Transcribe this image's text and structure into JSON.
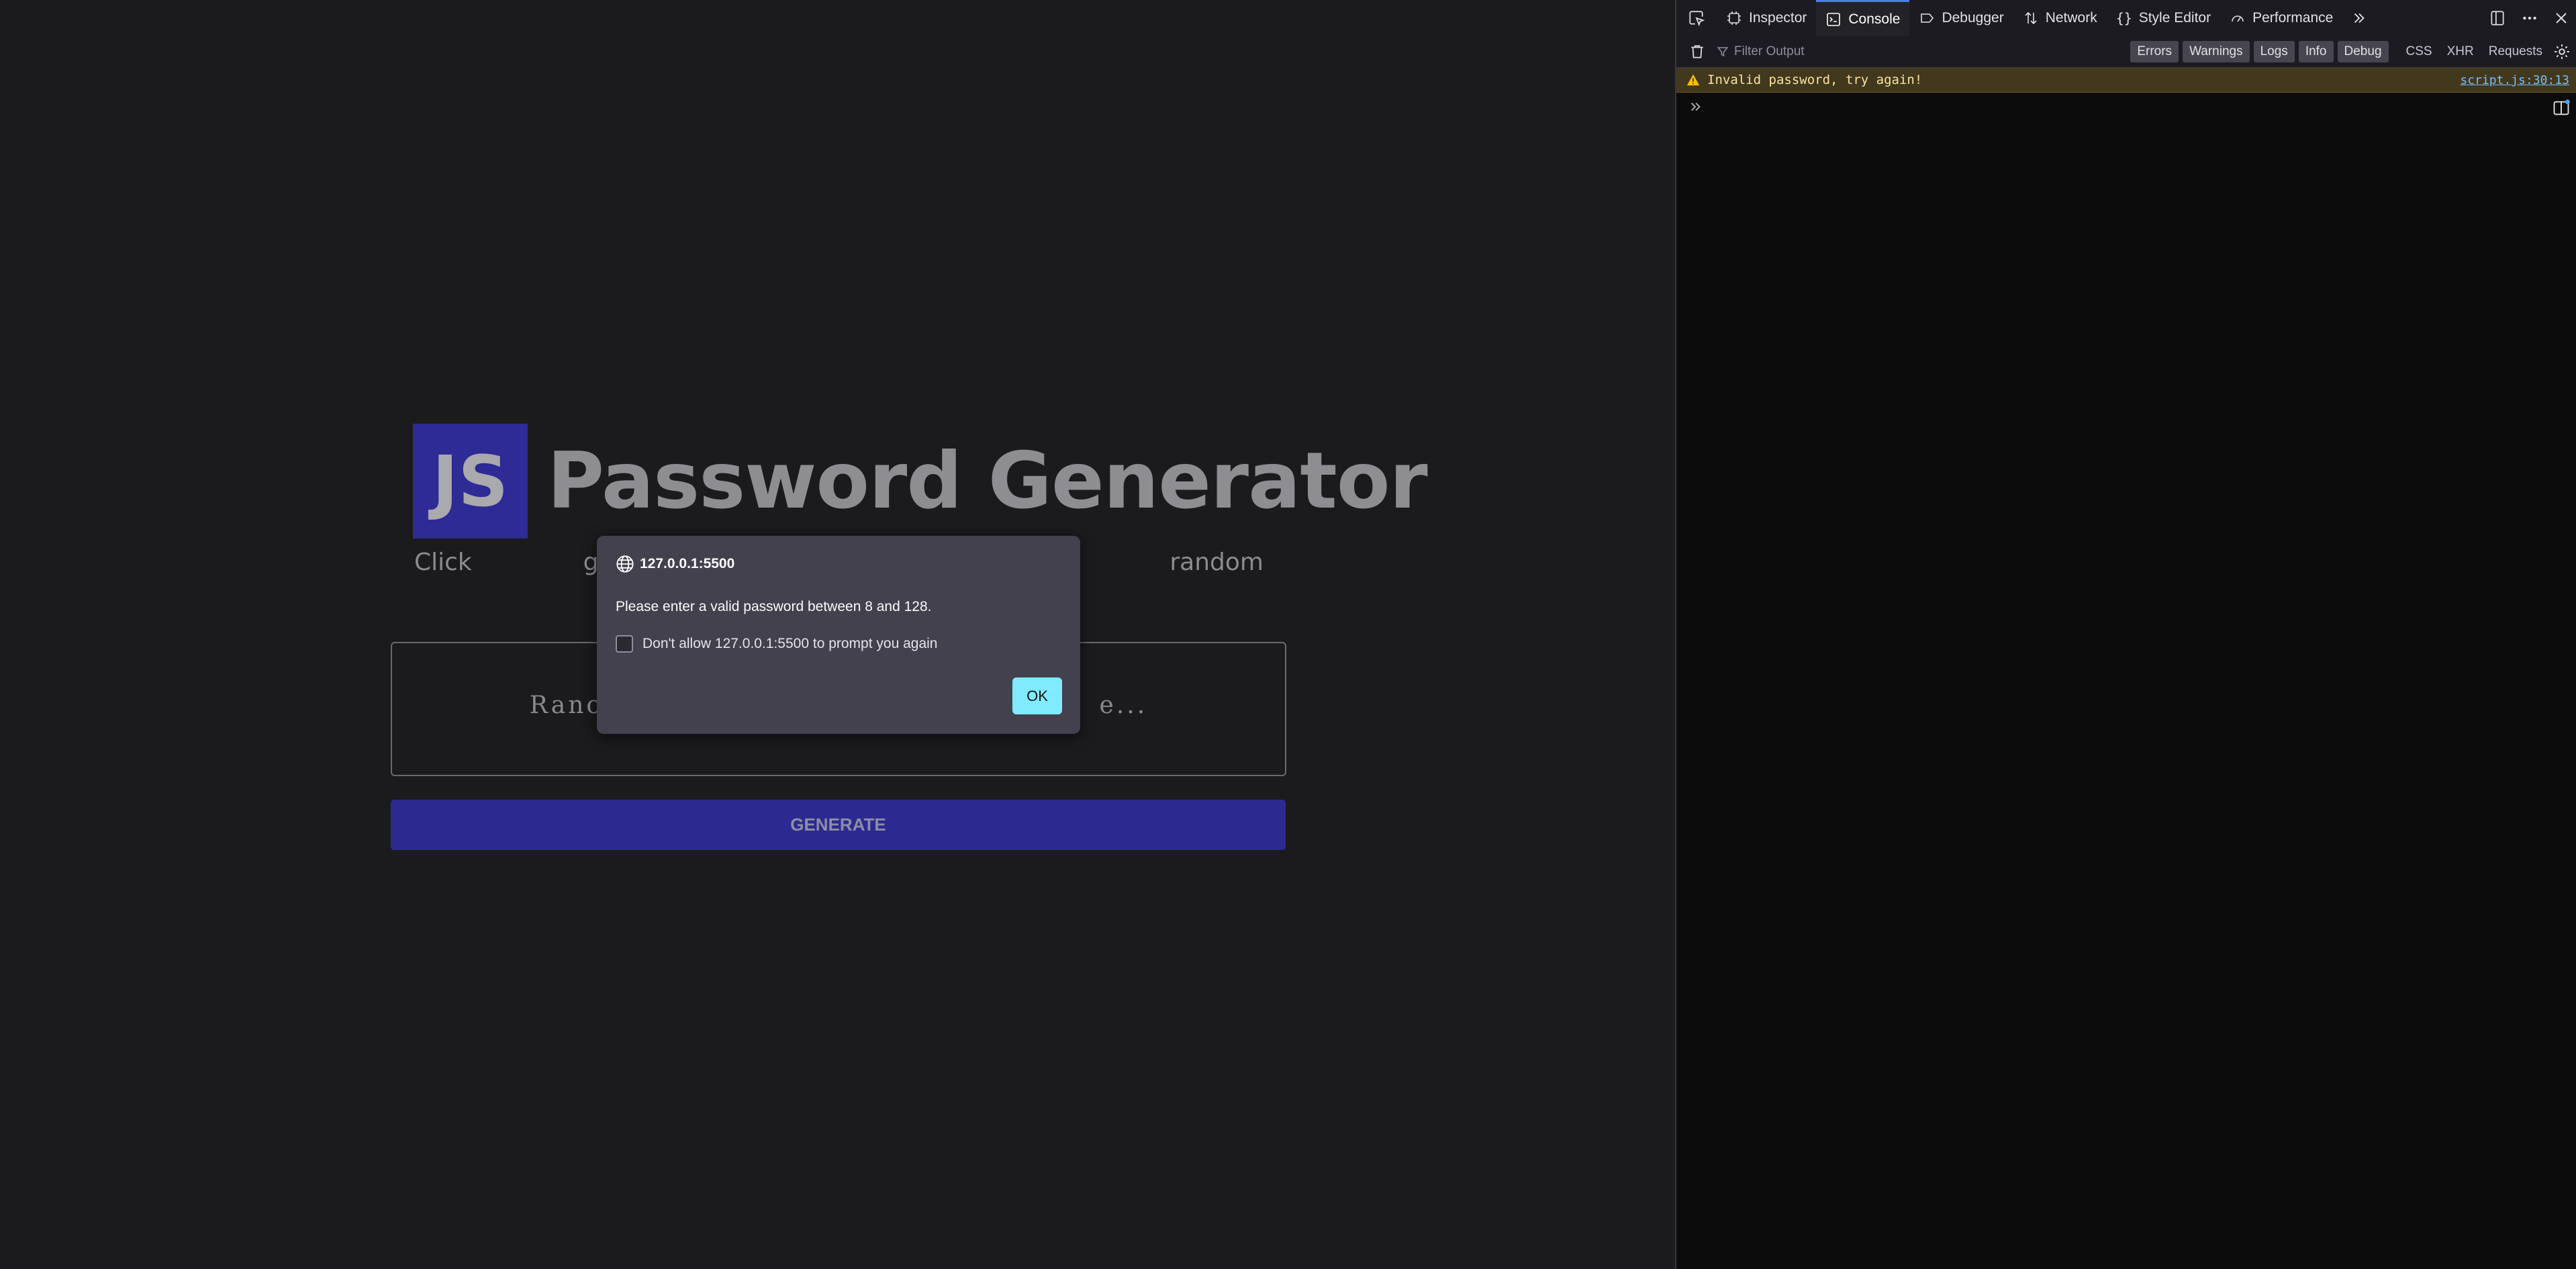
{
  "page": {
    "logo": "JS",
    "title": "Password Generator",
    "subtitle_left": "Click generate an",
    "subtitle_right": "complete random",
    "password_placeholder_left": "Ranc",
    "password_placeholder_right": "e...",
    "generate_label": "GENERATE"
  },
  "modal": {
    "origin": "127.0.0.1:5500",
    "message": "Please enter a valid password between 8 and 128.",
    "checkbox_label": "Don't allow 127.0.0.1:5500 to prompt you again",
    "ok_label": "OK"
  },
  "devtools": {
    "tabs": [
      "Inspector",
      "Console",
      "Debugger",
      "Network",
      "Style Editor",
      "Performance"
    ],
    "selected_tab": "Console",
    "filter_placeholder": "Filter Output",
    "levels": [
      "Errors",
      "Warnings",
      "Logs",
      "Info",
      "Debug"
    ],
    "requests": [
      "CSS",
      "XHR",
      "Requests"
    ],
    "messages": [
      {
        "level": "warning",
        "text": "Invalid password, try again!",
        "source": "script.js:30:13"
      }
    ]
  },
  "colors": {
    "accent_blue": "#2e2a96",
    "ok_button": "#80ebff",
    "modal_bg": "#42414d",
    "warning_bg": "#42381d",
    "warning_text": "#fce2a1"
  }
}
